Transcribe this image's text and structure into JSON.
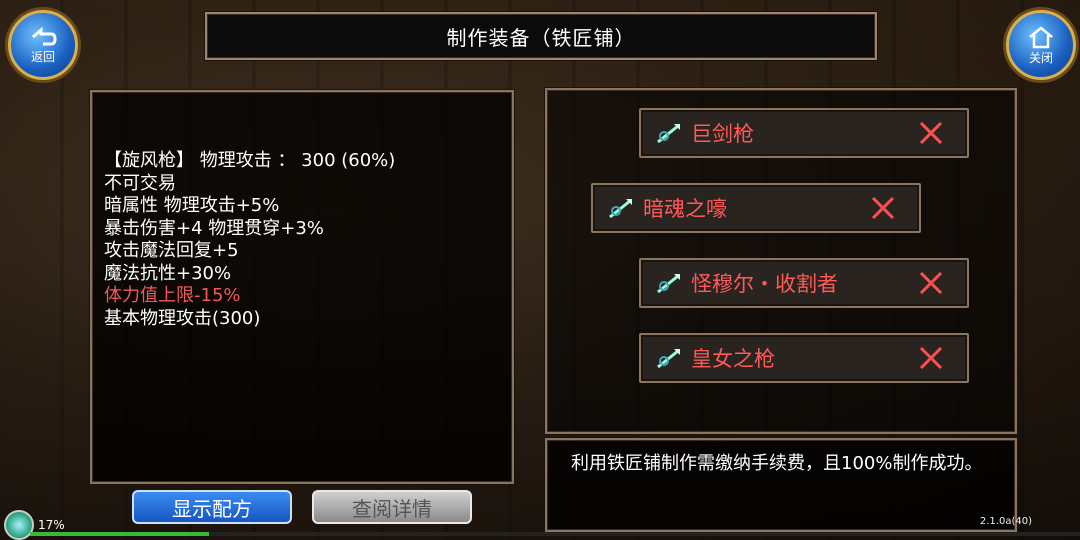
{
  "header": {
    "title": "制作装备（铁匠铺）"
  },
  "nav": {
    "back_label": "返回",
    "close_label": "关闭"
  },
  "item": {
    "lines": [
      "【旋风枪】 物理攻击 ：  300 (60%)",
      "不可交易",
      "暗属性 物理攻击+5%",
      "暴击伤害+4 物理贯穿+3%",
      "攻击魔法回复+5",
      "魔法抗性+30%",
      "体力值上限-15%",
      "基本物理攻击(300)"
    ]
  },
  "recipes": [
    {
      "name": "巨剑枪"
    },
    {
      "name": "暗魂之嚎"
    },
    {
      "name": "怪穆尔・收割者"
    },
    {
      "name": "皇女之枪"
    }
  ],
  "description": "利用铁匠铺制作需缴纳手续费，且100%制作成功。",
  "buttons": {
    "show_recipe": "显示配方",
    "view_details": "查阅详情"
  },
  "status": {
    "percent": "17%",
    "exp_fraction": 0.17,
    "version": "2.1.0a(40)"
  },
  "colors": {
    "recipe_text": "#ff5a5a",
    "penalty_text": "#f05a5a",
    "primary_button": "#1656c0"
  }
}
